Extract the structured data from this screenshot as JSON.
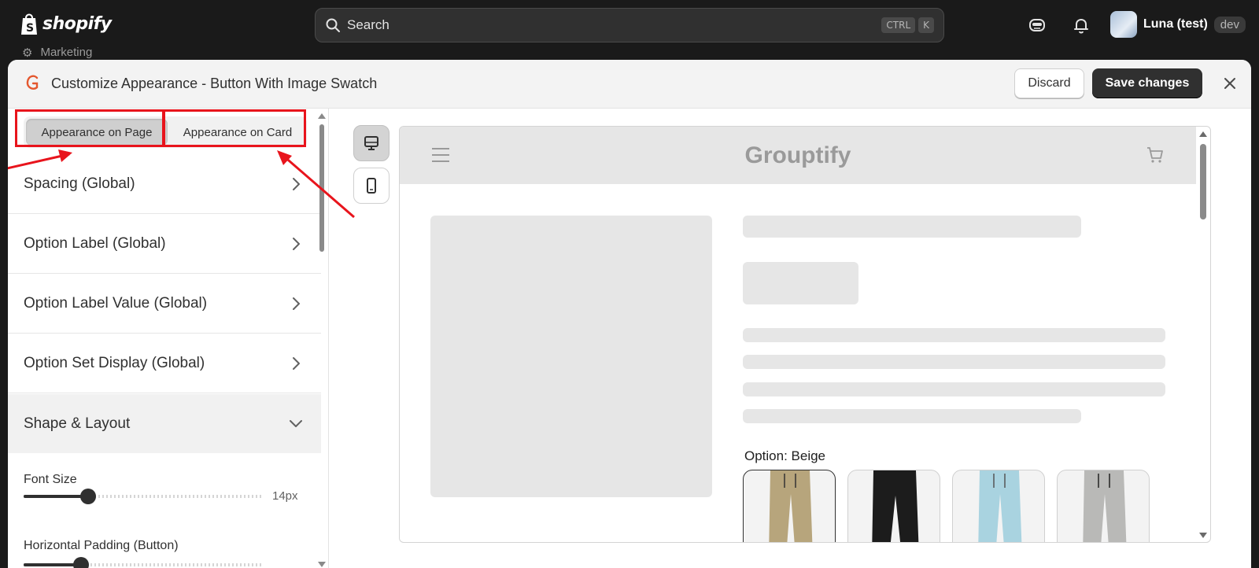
{
  "topbar": {
    "logo_text": "shopify",
    "search_placeholder": "Search",
    "shortcut_keys": [
      "CTRL",
      "K"
    ],
    "user_name": "Luna (test)",
    "user_badge": "dev"
  },
  "background": {
    "nav_item": "Marketing"
  },
  "modal": {
    "title": "Customize Appearance - Button With Image Swatch",
    "discard_label": "Discard",
    "save_label": "Save changes"
  },
  "sidebar": {
    "tabs": [
      {
        "label": "Appearance on Page",
        "active": true
      },
      {
        "label": "Appearance on Card",
        "active": false
      }
    ],
    "sections": [
      {
        "label": "Spacing (Global)"
      },
      {
        "label": "Option Label (Global)"
      },
      {
        "label": "Option Label Value (Global)"
      },
      {
        "label": "Option Set Display (Global)"
      },
      {
        "label": "Shape & Layout",
        "expanded": true
      }
    ],
    "fields": {
      "font_size": {
        "label": "Font Size",
        "value": "14px",
        "fraction": 0.27
      },
      "horizontal_padding": {
        "label": "Horizontal Padding (Button)",
        "fraction": 0.24
      }
    }
  },
  "preview": {
    "store_name": "Grouptify",
    "option_label": "Option: Beige",
    "swatches": [
      {
        "color": "Beige",
        "hex": "#b7a57c",
        "selected": true
      },
      {
        "color": "Black",
        "hex": "#1c1c1c",
        "selected": false
      },
      {
        "color": "Light Blue",
        "hex": "#a9d3e0",
        "selected": false
      },
      {
        "color": "Grey",
        "hex": "#b9b9b7",
        "selected": false
      }
    ]
  },
  "colors": {
    "annotation": "#e8141c",
    "primary_button": "#303030",
    "brand_icon": "#e4572e"
  }
}
